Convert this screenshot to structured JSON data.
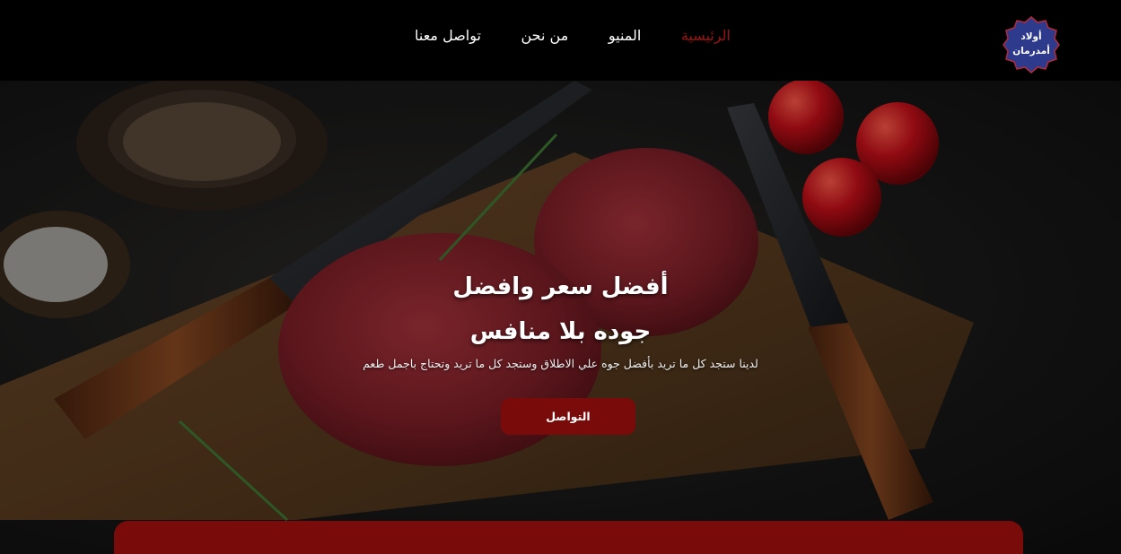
{
  "header": {
    "logo": {
      "line1": "أولاد",
      "line2": "أمدرمان",
      "color": "#2e3a8c"
    },
    "nav": [
      {
        "label": "الرئيسية",
        "active": true
      },
      {
        "label": "المنيو",
        "active": false
      },
      {
        "label": "من نحن",
        "active": false
      },
      {
        "label": "تواصل معنا",
        "active": false
      }
    ]
  },
  "hero": {
    "title_line1": "أفضل سعر وافضل",
    "title_line2": "جوده بلا منافس",
    "subtitle": "لدينا ستجد كل ما تريد بأفضل جوه علي الاطلاق وستجد كل ما تريد وتحتاج باجمل طعم",
    "cta_label": "التواصل"
  },
  "colors": {
    "accent": "#7a0b0b",
    "active_nav": "#9e1212",
    "header_bg": "#000000"
  }
}
